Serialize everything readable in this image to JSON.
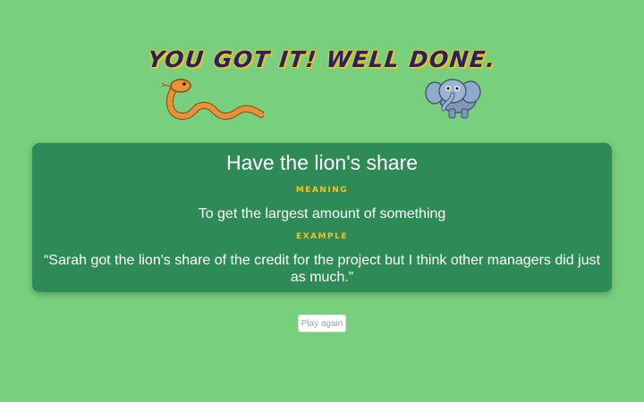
{
  "header": {
    "headline": "YOU GOT IT! WELL DONE."
  },
  "decorations": {
    "left_icon": "snake-icon",
    "right_icon": "elephant-icon"
  },
  "card": {
    "idiom": "Have the lion's share",
    "meaning_label": "MEANING",
    "meaning": "To get the largest amount of something",
    "example_label": "EXAMPLE",
    "example": "“Sarah got the lion's share of the credit for the project but I think other managers did just as much.”"
  },
  "actions": {
    "play_again_label": "Play again"
  },
  "colors": {
    "background": "#78d07f",
    "card": "#2e8b57",
    "headline": "#22236b",
    "accent_yellow": "#f3c21d"
  }
}
